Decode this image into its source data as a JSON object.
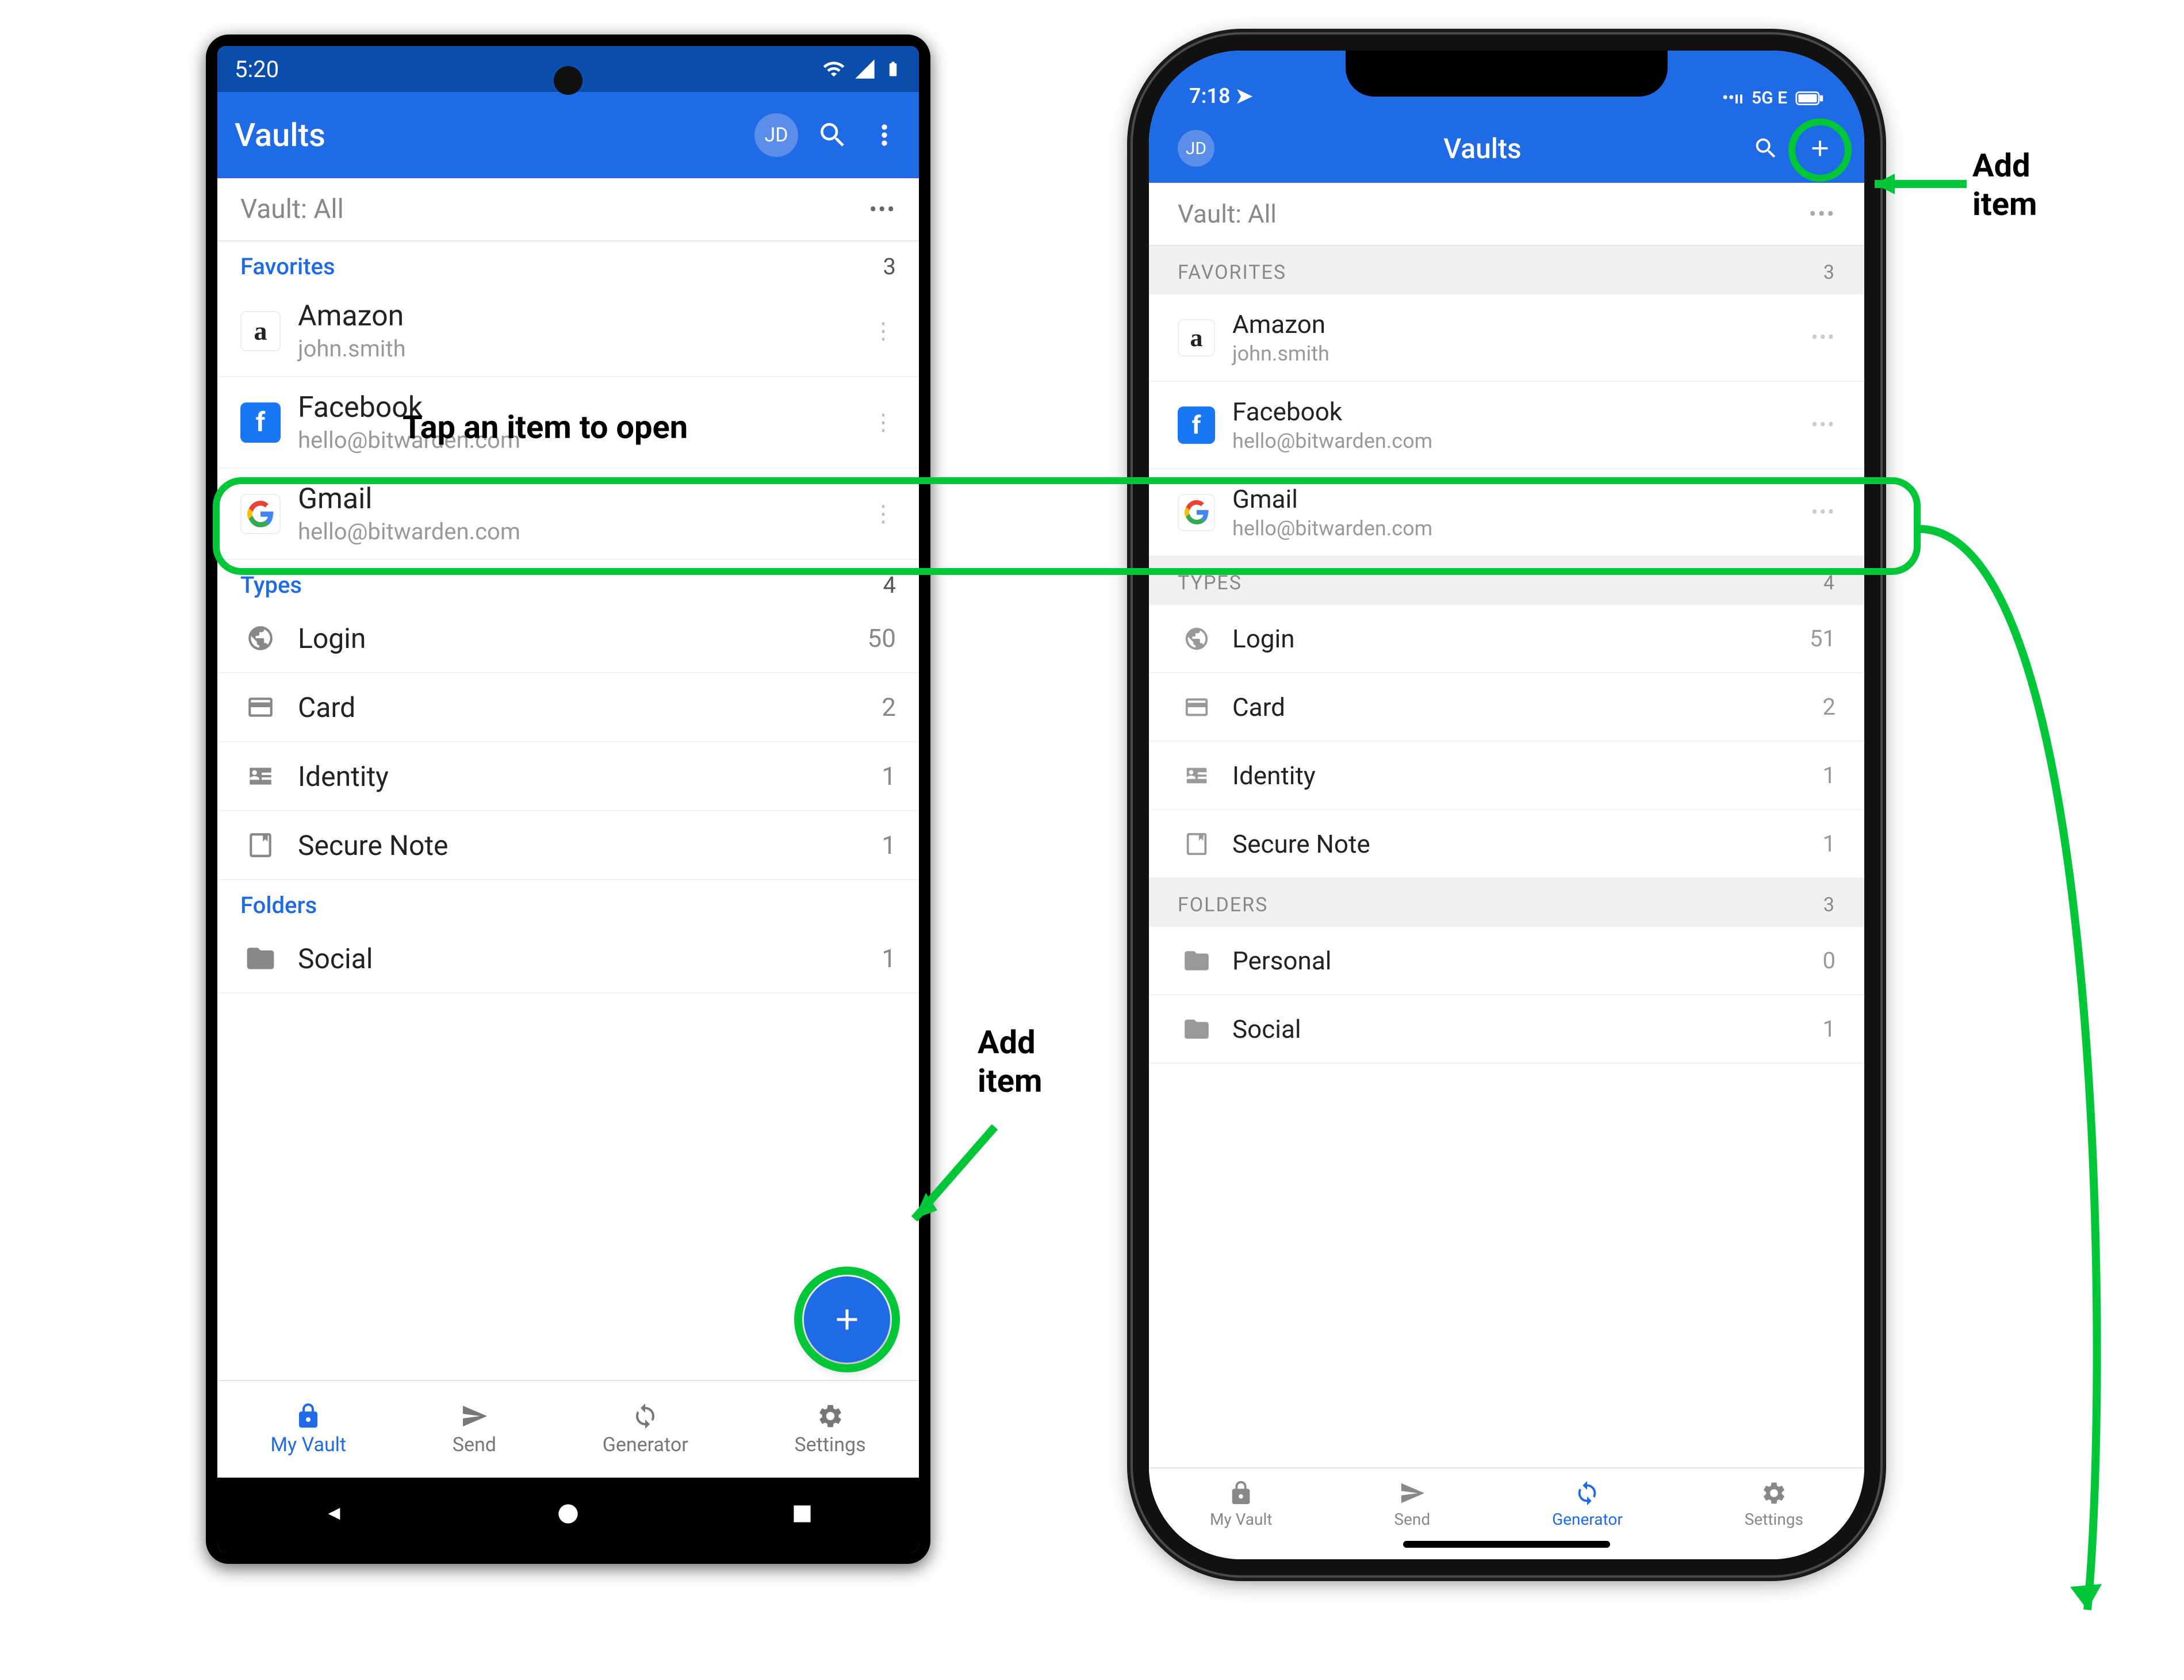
{
  "annotations": {
    "add_item_title": "Add",
    "add_item_sub": "item",
    "tap_to_open": "Tap an item to open"
  },
  "android": {
    "status": {
      "time": "5:20"
    },
    "appbar": {
      "title": "Vaults",
      "avatar": "JD"
    },
    "vault_filter": "Vault: All",
    "favorites_label": "Favorites",
    "favorites_count": "3",
    "items": [
      {
        "title": "Amazon",
        "subtitle": "john.smith"
      },
      {
        "title": "Facebook",
        "subtitle": "hello@bitwarden.com"
      },
      {
        "title": "Gmail",
        "subtitle": "hello@bitwarden.com"
      }
    ],
    "types_label": "Types",
    "types_count": "4",
    "types": [
      {
        "name": "Login",
        "count": "50"
      },
      {
        "name": "Card",
        "count": "2"
      },
      {
        "name": "Identity",
        "count": "1"
      },
      {
        "name": "Secure Note",
        "count": "1"
      }
    ],
    "folders_label": "Folders",
    "folders": [
      {
        "name": "Social",
        "count": "1"
      }
    ],
    "tabs": {
      "my_vault": "My Vault",
      "send": "Send",
      "generator": "Generator",
      "settings": "Settings"
    }
  },
  "ios": {
    "status": {
      "time": "7:18",
      "signal": "5G E"
    },
    "appbar": {
      "title": "Vaults",
      "avatar": "JD"
    },
    "vault_filter": "Vault: All",
    "favorites_label": "FAVORITES",
    "favorites_count": "3",
    "items": [
      {
        "title": "Amazon",
        "subtitle": "john.smith"
      },
      {
        "title": "Facebook",
        "subtitle": "hello@bitwarden.com"
      },
      {
        "title": "Gmail",
        "subtitle": "hello@bitwarden.com"
      }
    ],
    "types_label": "TYPES",
    "types_count": "4",
    "types": [
      {
        "name": "Login",
        "count": "51"
      },
      {
        "name": "Card",
        "count": "2"
      },
      {
        "name": "Identity",
        "count": "1"
      },
      {
        "name": "Secure Note",
        "count": "1"
      }
    ],
    "folders_label": "FOLDERS",
    "folders_count": "3",
    "folders": [
      {
        "name": "Personal",
        "count": "0"
      },
      {
        "name": "Social",
        "count": "1"
      }
    ],
    "tabs": {
      "my_vault": "My Vault",
      "send": "Send",
      "generator": "Generator",
      "settings": "Settings"
    }
  }
}
